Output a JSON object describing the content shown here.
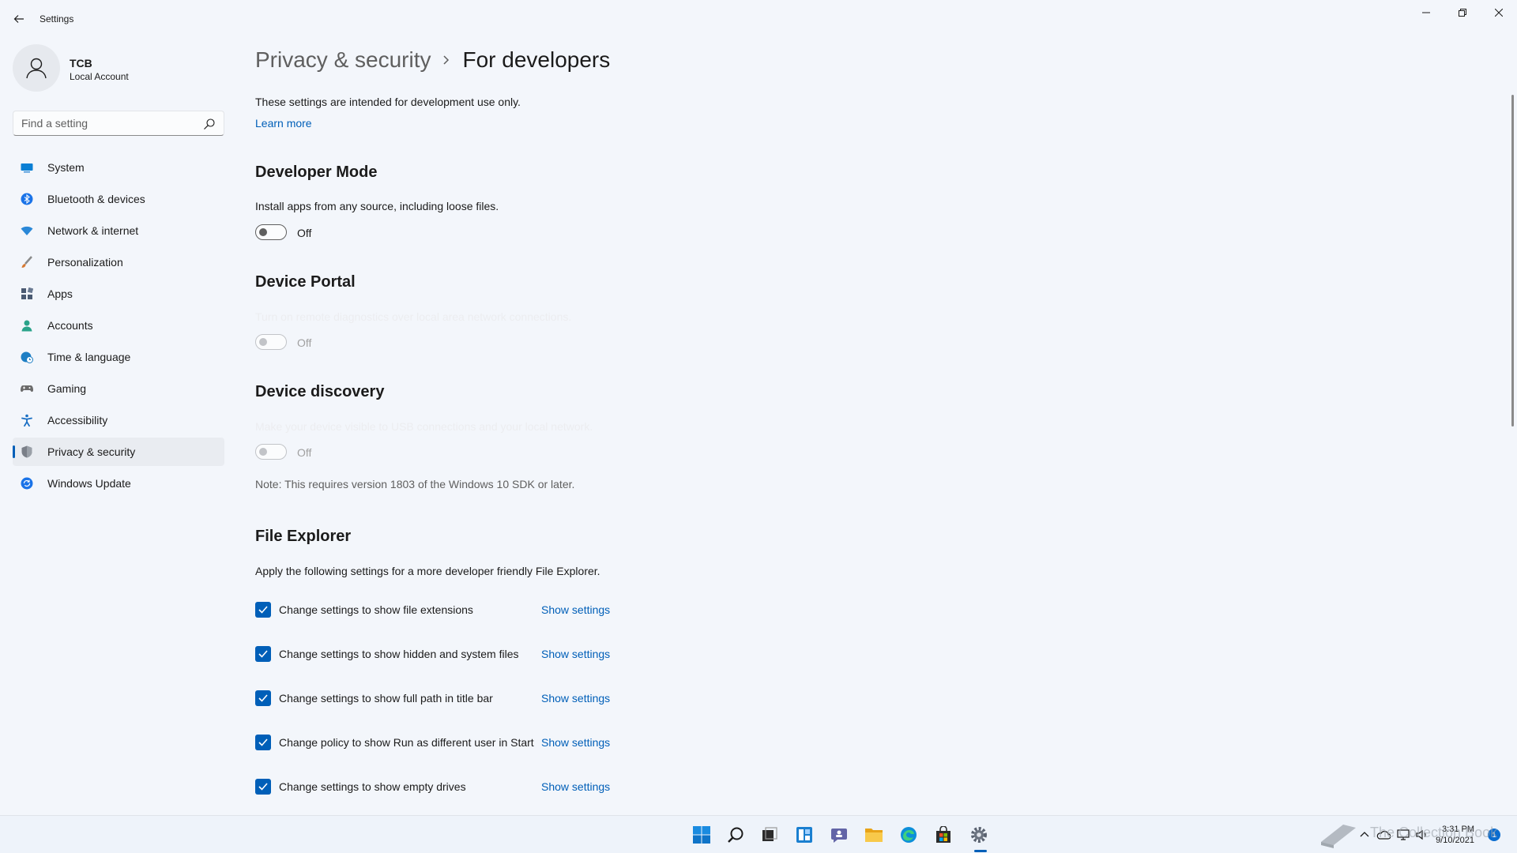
{
  "window": {
    "title": "Settings"
  },
  "profile": {
    "name": "TCB",
    "account_type": "Local Account"
  },
  "search": {
    "placeholder": "Find a setting"
  },
  "sidebar": {
    "items": [
      {
        "label": "System",
        "icon": "monitor-icon",
        "color": "#0a7fd4"
      },
      {
        "label": "Bluetooth & devices",
        "icon": "bluetooth-icon",
        "color": "#1a73e8"
      },
      {
        "label": "Network & internet",
        "icon": "wifi-icon",
        "color": "#2a88d8"
      },
      {
        "label": "Personalization",
        "icon": "brush-icon",
        "color": "#d67a34"
      },
      {
        "label": "Apps",
        "icon": "apps-icon",
        "color": "#4a5a72"
      },
      {
        "label": "Accounts",
        "icon": "person-icon",
        "color": "#2aa38a"
      },
      {
        "label": "Time & language",
        "icon": "globe-clock-icon",
        "color": "#1d7ec4"
      },
      {
        "label": "Gaming",
        "icon": "gamepad-icon",
        "color": "#6b6b6b"
      },
      {
        "label": "Accessibility",
        "icon": "accessibility-icon",
        "color": "#1a6fc4"
      },
      {
        "label": "Privacy & security",
        "icon": "shield-icon",
        "color": "#7a7f88",
        "active": true
      },
      {
        "label": "Windows Update",
        "icon": "update-icon",
        "color": "#1a73e8"
      }
    ]
  },
  "breadcrumb": {
    "parent": "Privacy & security",
    "current": "For developers"
  },
  "intro": {
    "text": "These settings are intended for development use only.",
    "link": "Learn more"
  },
  "developer_mode": {
    "title": "Developer Mode",
    "description": "Install apps from any source, including loose files.",
    "state": "Off"
  },
  "device_portal": {
    "title": "Device Portal",
    "description": "Turn on remote diagnostics over local area network connections.",
    "state": "Off"
  },
  "device_discovery": {
    "title": "Device discovery",
    "description": "Make your device visible to USB connections and your local network.",
    "state": "Off",
    "note": "Note: This requires version 1803 of the Windows 10 SDK or later."
  },
  "file_explorer": {
    "title": "File Explorer",
    "description": "Apply the following settings for a more developer friendly File Explorer.",
    "options": [
      {
        "label": "Change settings to show file extensions",
        "link": "Show settings",
        "checked": true
      },
      {
        "label": "Change settings to show hidden and system files",
        "link": "Show settings",
        "checked": true
      },
      {
        "label": "Change settings to show full path in title bar",
        "link": "Show settings",
        "checked": true
      },
      {
        "label": "Change policy to show Run as different user in Start",
        "link": "Show settings",
        "checked": true
      },
      {
        "label": "Change settings to show empty drives",
        "link": "Show settings",
        "checked": true
      }
    ]
  },
  "taskbar": {
    "apps": [
      "windows-start-icon",
      "search-icon",
      "task-view-icon",
      "widgets-icon",
      "chat-icon",
      "file-explorer-icon",
      "edge-icon",
      "store-icon",
      "settings-icon"
    ],
    "time": "3:31 PM",
    "date": "9/10/2021",
    "notification_count": "1",
    "watermark": "The Collection Book"
  },
  "colors": {
    "accent": "#005fb8",
    "background": "#f3f6fb"
  }
}
